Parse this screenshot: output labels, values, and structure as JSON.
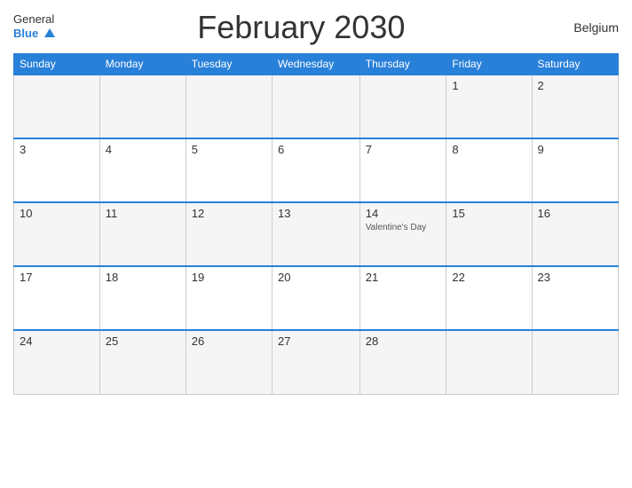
{
  "header": {
    "logo_general": "General",
    "logo_blue": "Blue",
    "title": "February 2030",
    "country": "Belgium"
  },
  "days_of_week": [
    "Sunday",
    "Monday",
    "Tuesday",
    "Wednesday",
    "Thursday",
    "Friday",
    "Saturday"
  ],
  "weeks": [
    [
      {
        "day": "",
        "event": ""
      },
      {
        "day": "",
        "event": ""
      },
      {
        "day": "",
        "event": ""
      },
      {
        "day": "",
        "event": ""
      },
      {
        "day": "",
        "event": ""
      },
      {
        "day": "1",
        "event": ""
      },
      {
        "day": "2",
        "event": ""
      }
    ],
    [
      {
        "day": "3",
        "event": ""
      },
      {
        "day": "4",
        "event": ""
      },
      {
        "day": "5",
        "event": ""
      },
      {
        "day": "6",
        "event": ""
      },
      {
        "day": "7",
        "event": ""
      },
      {
        "day": "8",
        "event": ""
      },
      {
        "day": "9",
        "event": ""
      }
    ],
    [
      {
        "day": "10",
        "event": ""
      },
      {
        "day": "11",
        "event": ""
      },
      {
        "day": "12",
        "event": ""
      },
      {
        "day": "13",
        "event": ""
      },
      {
        "day": "14",
        "event": "Valentine's Day"
      },
      {
        "day": "15",
        "event": ""
      },
      {
        "day": "16",
        "event": ""
      }
    ],
    [
      {
        "day": "17",
        "event": ""
      },
      {
        "day": "18",
        "event": ""
      },
      {
        "day": "19",
        "event": ""
      },
      {
        "day": "20",
        "event": ""
      },
      {
        "day": "21",
        "event": ""
      },
      {
        "day": "22",
        "event": ""
      },
      {
        "day": "23",
        "event": ""
      }
    ],
    [
      {
        "day": "24",
        "event": ""
      },
      {
        "day": "25",
        "event": ""
      },
      {
        "day": "26",
        "event": ""
      },
      {
        "day": "27",
        "event": ""
      },
      {
        "day": "28",
        "event": ""
      },
      {
        "day": "",
        "event": ""
      },
      {
        "day": "",
        "event": ""
      }
    ]
  ]
}
